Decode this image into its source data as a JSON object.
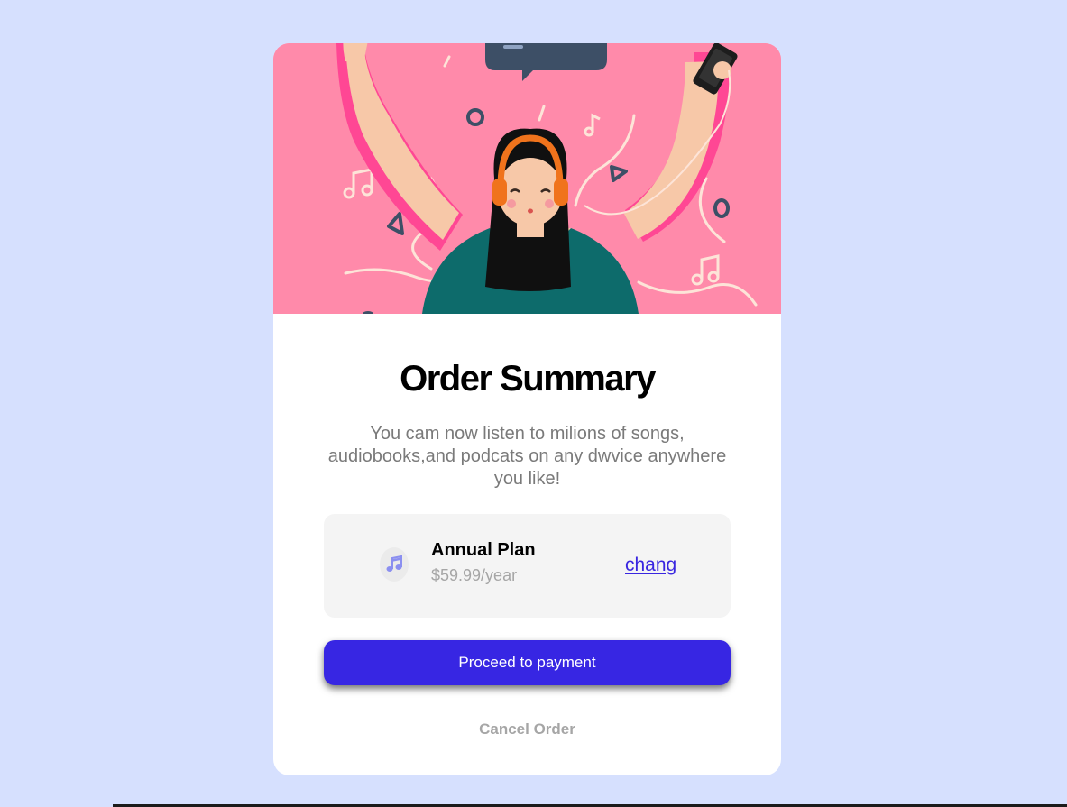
{
  "summary": {
    "title": "Order Summary",
    "description": "You cam now listen to milions of songs, audiobooks,and podcats on any dwvice anywhere you like!"
  },
  "plan": {
    "icon": "music-note-icon",
    "name": "Annual Plan",
    "price": "$59.99/year",
    "change_label": "chang"
  },
  "actions": {
    "proceed_label": "Proceed to payment",
    "cancel_label": "Cancel Order"
  },
  "colors": {
    "background": "#d6e0fe",
    "hero": "#ff8aaa",
    "accent": "#3726e3",
    "muted_text": "#a6a6a6"
  }
}
